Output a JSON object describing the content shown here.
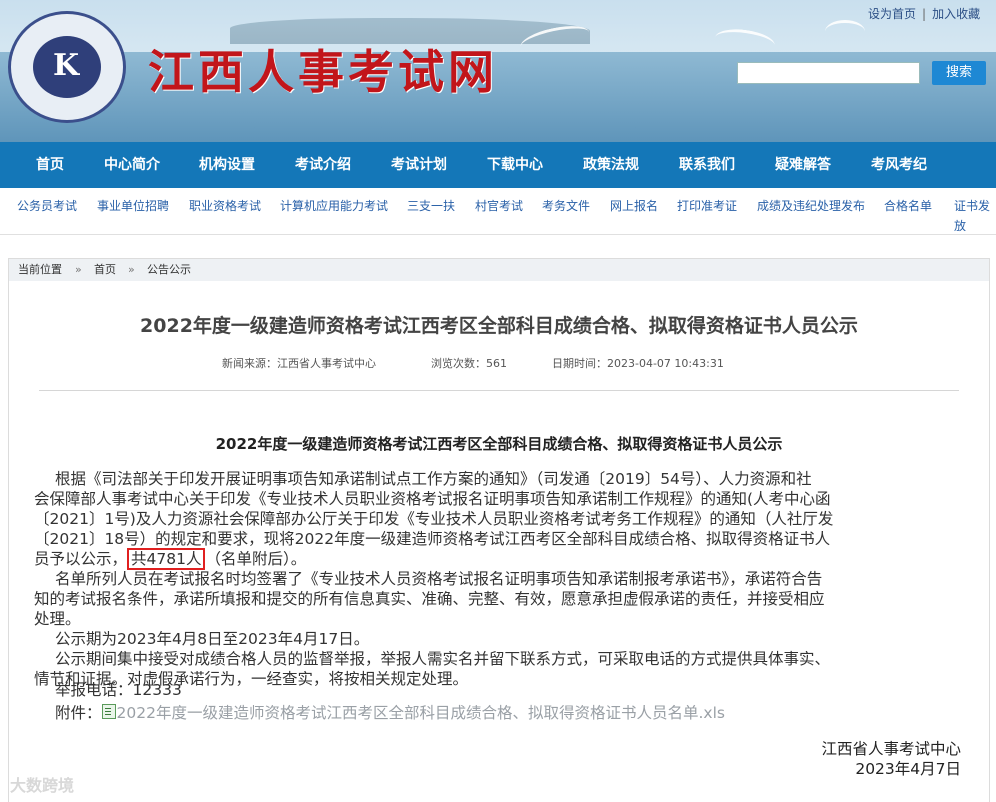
{
  "header": {
    "site_title": "江西人事考试网",
    "logo_mark": "K",
    "top_links": [
      "设为首页",
      "加入收藏"
    ],
    "search_button": "搜索",
    "search_placeholder": ""
  },
  "nav": [
    "首页",
    "中心简介",
    "机构设置",
    "考试介绍",
    "考试计划",
    "下载中心",
    "政策法规",
    "联系我们",
    "疑难解答",
    "考风考纪"
  ],
  "subnav": [
    "公务员考试",
    "事业单位招聘",
    "职业资格考试",
    "计算机应用能力考试",
    "三支一扶",
    "村官考试",
    "考务文件",
    "网上报名",
    "打印准考证",
    "成绩及违纪处理发布",
    "合格名单",
    "证书发放"
  ],
  "breadcrumb": {
    "label": "当前位置",
    "items": [
      "首页",
      "公告公示"
    ],
    "sep": "»"
  },
  "article": {
    "title": "2022年度一级建造师资格考试江西考区全部科目成绩合格、拟取得资格证书人员公示",
    "source": "新闻来源：江西省人事考试中心",
    "views": "浏览次数：561",
    "date": "日期时间：2023-04-07 10:43:31",
    "content_title": "2022年度一级建造师资格考试江西考区全部科目成绩合格、拟取得资格证书人员公示",
    "para1_l1": "根据《司法部关于印发开展证明事项告知承诺制试点工作方案的通知》（司发通〔2019〕54号）、人力资源和社",
    "para1_l2": "会保障部人事考试中心关于印发《专业技术人员职业资格考试报名证明事项告知承诺制工作规程》的通知(人考中心函",
    "para1_l3": "〔2021〕1号)及人力资源社会保障部办公厅关于印发《专业技术人员职业资格考试考务工作规程》的通知（人社厅发",
    "para1_l4": "〔2021〕18号）的规定和要求，现将2022年度一级建造师资格考试江西考区全部科目成绩合格、拟取得资格证书人",
    "para1_l5a": "员予以公示，",
    "para1_highlight": "共4781人",
    "para1_l5b": "（名单附后）。",
    "para2_l1": "名单所列人员在考试报名时均签署了《专业技术人员资格考试报名证明事项告知承诺制报考承诺书》，承诺符合告",
    "para2_l2": "知的考试报名条件，承诺所填报和提交的所有信息真实、准确、完整、有效，愿意承担虚假承诺的责任，并接受相应",
    "para2_l3": "处理。",
    "para3": "公示期为2023年4月8日至2023年4月17日。",
    "para4_l1": "公示期间集中接受对成绩合格人员的监督举报，举报人需实名并留下联系方式，可采取电话的方式提供具体事实、",
    "para4_l2": "情节和证据。对虚假承诺行为，一经查实，将按相关规定处理。",
    "phone": "举报电话：12333",
    "attach_label": "附件：",
    "attach_file": "2022年度一级建造师资格考试江西考区全部科目成绩合格、拟取得资格证书人员名单.xls",
    "sign_org": "江西省人事考试中心",
    "sign_date": "2023年4月7日"
  },
  "watermark": "大数跨境"
}
